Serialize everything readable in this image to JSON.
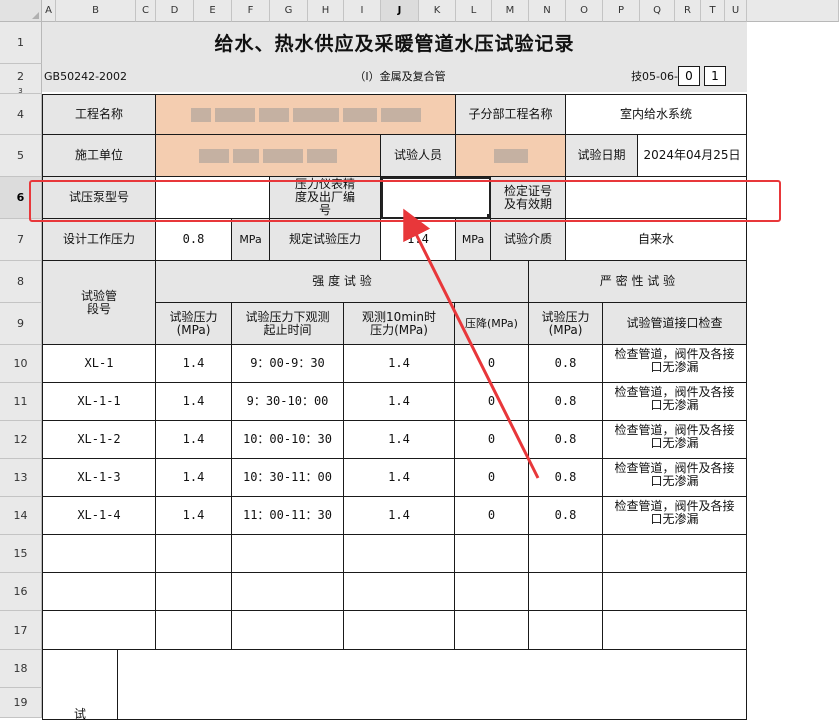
{
  "sheet": {
    "col_headers": [
      "A",
      "B",
      "C",
      "D",
      "E",
      "F",
      "G",
      "H",
      "I",
      "J",
      "K",
      "L",
      "M",
      "N",
      "O",
      "P",
      "Q",
      "R",
      "T",
      "U"
    ],
    "selected_col": "J",
    "row_headers": [
      "1",
      "2",
      "3",
      "4",
      "5",
      "6",
      "7",
      "8",
      "9",
      "10",
      "11",
      "12",
      "13",
      "14",
      "15",
      "16",
      "17",
      "18",
      "19"
    ],
    "selected_row": "6"
  },
  "doc": {
    "title": "给水、热水供应及采暖管道水压试验记录",
    "standard": "GB50242-2002",
    "subtitle": "（I）金属及复合管",
    "code_label": "技05-06-",
    "code_box1": "0",
    "code_box2": "1"
  },
  "info": {
    "project_name_label": "工程名称",
    "sub_project_label": "子分部工程名称",
    "sub_project_value": "室内给水系统",
    "constructor_label": "施工单位",
    "tester_label": "试验人员",
    "test_date_label": "试验日期",
    "test_date_value": "2024年04月25日",
    "pump_model_label": "试压泵型号",
    "gauge_label": "压力仪表精度及出厂编号",
    "cert_label": "检定证号及有效期",
    "design_pressure_label": "设计工作压力",
    "design_pressure_value": "0.8",
    "unit_mpa": "MPa",
    "spec_pressure_label": "规定试验压力",
    "spec_pressure_value": "1.4",
    "medium_label": "试验介质",
    "medium_value": "自来水"
  },
  "table": {
    "pipe_section_label": "试验管段号",
    "strength_label": "强 度 试 验",
    "tightness_label": "严 密 性 试 验",
    "col_test_pressure": "试验压力(MPa)",
    "col_time": "试验压力下观测起止时间",
    "col_10min": "观测10min时压力(MPa)",
    "col_drop": "压降(MPa)",
    "col_tight_pressure": "试验压力(MPa)",
    "col_joint_check": "试验管道接口检查",
    "rows": [
      {
        "section": "XL-1",
        "pressure": "1.4",
        "time": "9：00-9：30",
        "p10": "1.4",
        "drop": "0",
        "tight": "0.8",
        "check": "检查管道，阀件及各接口无渗漏"
      },
      {
        "section": "XL-1-1",
        "pressure": "1.4",
        "time": "9：30-10：00",
        "p10": "1.4",
        "drop": "0",
        "tight": "0.8",
        "check": "检查管道，阀件及各接口无渗漏"
      },
      {
        "section": "XL-1-2",
        "pressure": "1.4",
        "time": "10：00-10：30",
        "p10": "1.4",
        "drop": "0",
        "tight": "0.8",
        "check": "检查管道，阀件及各接口无渗漏"
      },
      {
        "section": "XL-1-3",
        "pressure": "1.4",
        "time": "10：30-11：00",
        "p10": "1.4",
        "drop": "0",
        "tight": "0.8",
        "check": "检查管道，阀件及各接口无渗漏"
      },
      {
        "section": "XL-1-4",
        "pressure": "1.4",
        "time": "11：00-11：30",
        "p10": "1.4",
        "drop": "0",
        "tight": "0.8",
        "check": "检查管道，阀件及各接口无渗漏"
      }
    ],
    "footer_label": "试"
  },
  "annotation": {
    "color": "#e8373a"
  }
}
